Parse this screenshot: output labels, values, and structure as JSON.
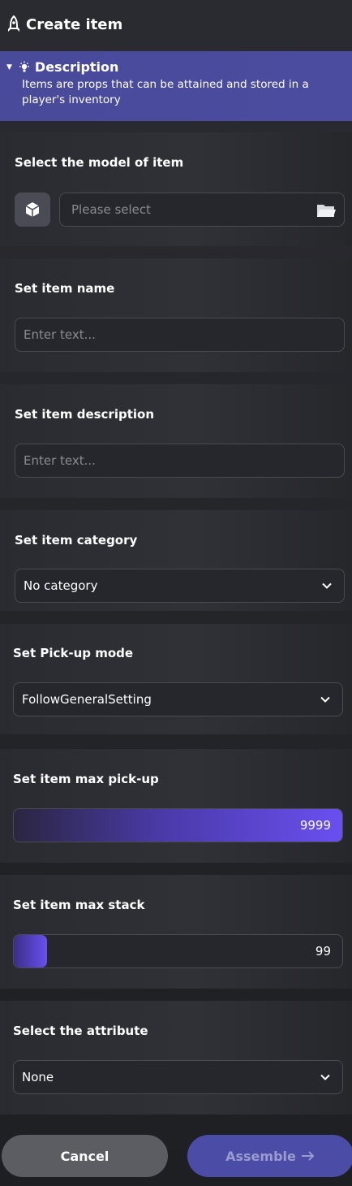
{
  "header": {
    "title": "Create item",
    "icon": "rocket-icon"
  },
  "description": {
    "title": "Description",
    "text": "Items are props that can be attained and stored in a player's inventory"
  },
  "model": {
    "label": "Select the model of item",
    "placeholder": "Please select"
  },
  "item_name": {
    "label": "Set item name",
    "placeholder": "Enter text..."
  },
  "item_description": {
    "label": "Set item description",
    "placeholder": "Enter text..."
  },
  "category": {
    "label": "Set item category",
    "value": "No category"
  },
  "pickup_mode": {
    "label": "Set Pick-up mode",
    "value": "FollowGeneralSetting"
  },
  "max_pickup": {
    "label": "Set item max pick-up",
    "value": "9999",
    "fill_fraction": 1.0
  },
  "max_stack": {
    "label": "Set item max stack",
    "value": "99",
    "fill_fraction": 0.1
  },
  "attribute": {
    "label": "Select the attribute",
    "value": "None"
  },
  "footer": {
    "cancel_label": "Cancel",
    "assemble_label": "Assemble"
  },
  "colors": {
    "accent": "#6a4ff0",
    "description_bg": "#4a4a9a",
    "assemble_bg": "#4a4ca6",
    "cancel_bg": "#5c5d62"
  }
}
